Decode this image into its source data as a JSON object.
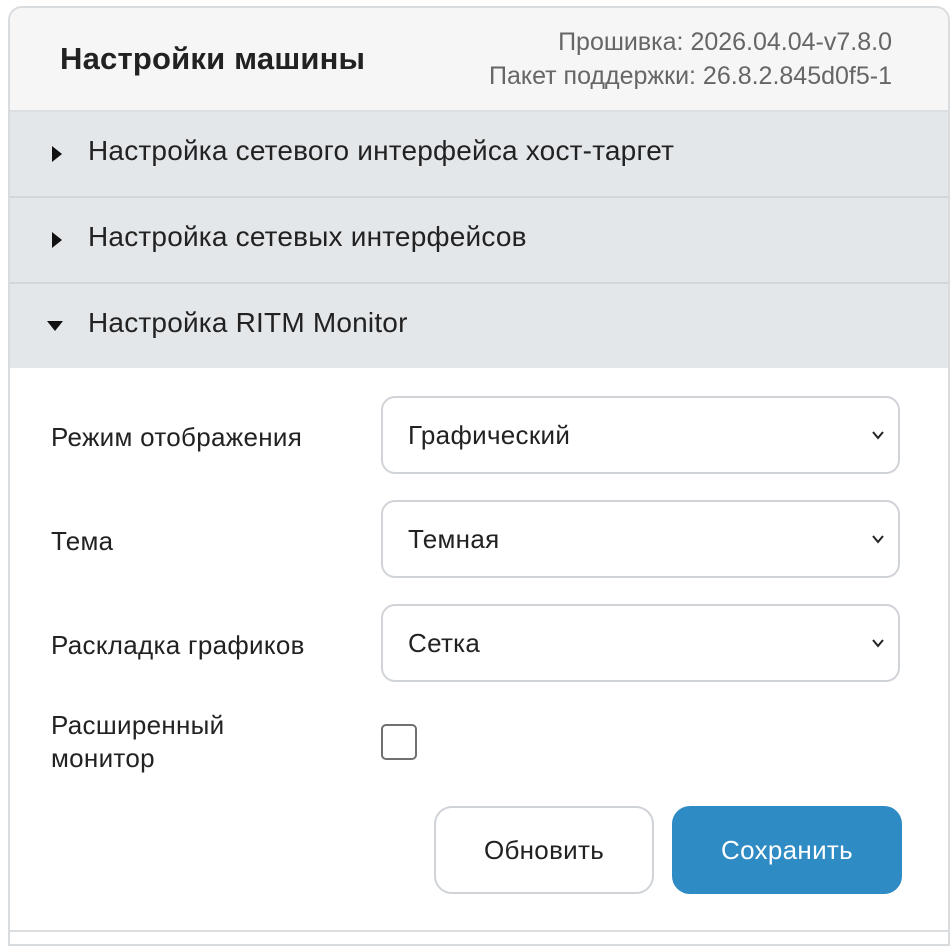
{
  "header": {
    "title": "Настройки машины",
    "firmware": "Прошивка: 2026.04.04-v7.8.0",
    "support_package": "Пакет поддержки: 26.8.2.845d0f5-1"
  },
  "accordion": {
    "items": [
      {
        "label": "Настройка сетевого интерфейса хост-таргет",
        "expanded": false
      },
      {
        "label": "Настройка сетевых интерфейсов",
        "expanded": false
      },
      {
        "label": "Настройка RITM Monitor",
        "expanded": true
      }
    ]
  },
  "ritm": {
    "display_mode": {
      "label": "Режим отображения",
      "value": "Графический"
    },
    "theme": {
      "label": "Тема",
      "value": "Темная"
    },
    "layout": {
      "label": "Раскладка графиков",
      "value": "Сетка"
    },
    "extended_monitor": {
      "label_line1": "Расширенный",
      "label_line2": "монитор",
      "checked": false
    },
    "refresh_label": "Обновить",
    "save_label": "Сохранить"
  },
  "colors": {
    "accent": "#2f8bc4",
    "accordion_bg": "#e3e7ea",
    "header_bg": "#f6f6f6"
  },
  "icons": {
    "collapsed": "caret-right-icon",
    "expanded": "caret-down-icon",
    "select": "chevron-down-icon"
  }
}
